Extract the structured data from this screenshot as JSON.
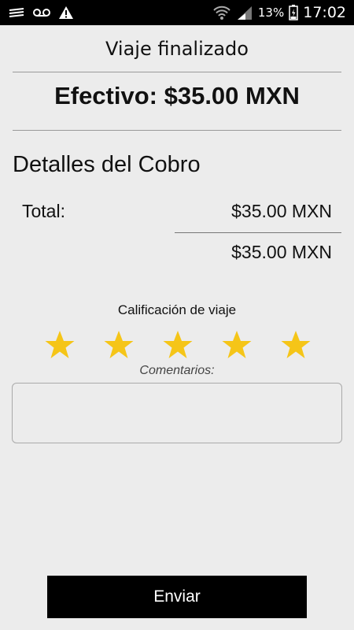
{
  "status_bar": {
    "battery_percent": "13%",
    "time": "17:02",
    "icons": [
      "notification-lines-icon",
      "voicemail-icon",
      "warning-icon",
      "wifi-icon",
      "signal-icon",
      "battery-icon"
    ]
  },
  "header": {
    "title": "Viaje finalizado"
  },
  "summary": {
    "payment_text": "Efectivo: $35.00 MXN"
  },
  "details": {
    "section_title": "Detalles del Cobro",
    "total_label": "Total:",
    "total_value": "$35.00 MXN",
    "sum_value": "$35.00 MXN"
  },
  "rating": {
    "label": "Calificación de viaje",
    "stars": 5,
    "max_stars": 5,
    "star_color": "#f5c518"
  },
  "comments": {
    "label": "Comentarios:",
    "value": "",
    "placeholder": ""
  },
  "actions": {
    "submit_label": "Enviar"
  }
}
